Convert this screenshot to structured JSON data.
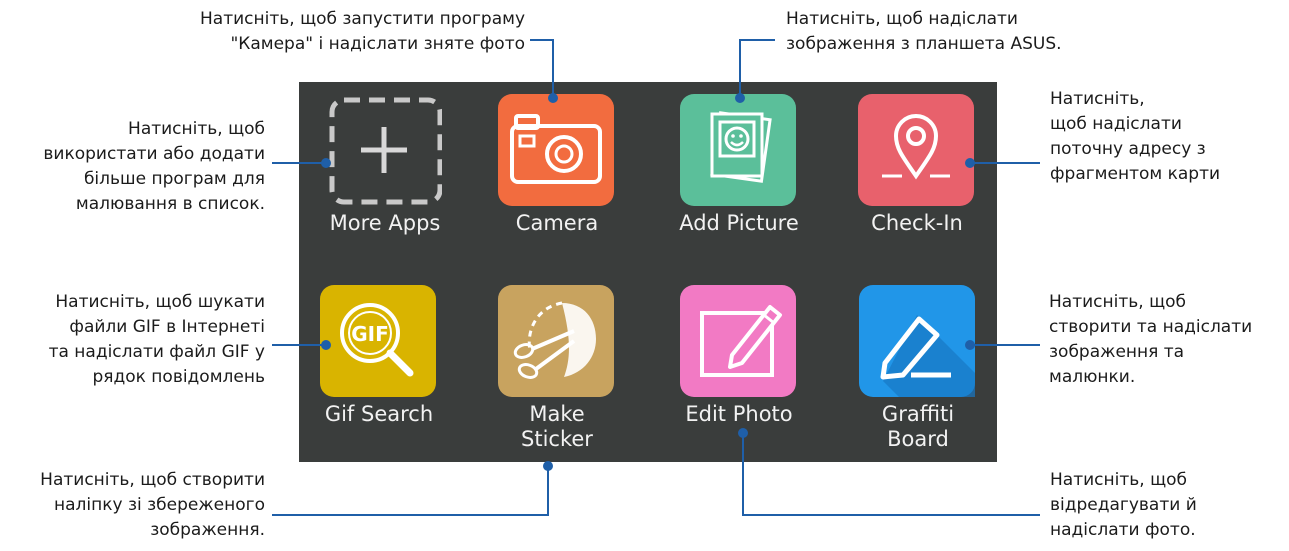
{
  "colors": {
    "panel": "#3a3d3c",
    "leader": "#1f5fa8",
    "camera": "#f26c3f",
    "add_picture": "#5bbf9a",
    "check_in": "#e8616c",
    "gif_search": "#d9b400",
    "make_sticker": "#c8a35f",
    "edit_photo": "#f27ac4",
    "graffiti_board": "#2196e8"
  },
  "apps": [
    {
      "label": "More Apps",
      "icon": "plus-dashed-icon"
    },
    {
      "label": "Camera",
      "icon": "camera-icon"
    },
    {
      "label": "Add Picture",
      "icon": "photo-stack-icon"
    },
    {
      "label": "Check-In",
      "icon": "map-pin-icon"
    },
    {
      "label": "Gif Search",
      "icon": "gif-magnifier-icon"
    },
    {
      "label": "Make\nSticker",
      "icon": "scissors-icon"
    },
    {
      "label": "Edit Photo",
      "icon": "pencil-frame-icon"
    },
    {
      "label": "Graffiti\nBoard",
      "icon": "pen-icon"
    }
  ],
  "callouts": {
    "camera": "Натисніть, щоб запустити програму\n\"Камера\" і надіслати зняте фото",
    "add_picture": "Натисніть, щоб надіслати\nзображення з планшета ASUS.",
    "more_apps": "Натисніть, щоб\nвикористати або додати\nбільше програм для\nмалювання в список.",
    "check_in": "Натисніть,\nщоб надіслати\nпоточну адресу з\nфрагментом карти",
    "gif_search": "Натисніть, щоб шукати\nфайли GIF в Інтернеті\nта надіслати файл GIF у\nрядок повідомлень",
    "graffiti_board": "Натисніть, щоб\nстворити та надіслати\nзображення та\nмалюнки.",
    "make_sticker": "Натисніть, щоб створити\nналіпку зі збереженого\nзображення.",
    "edit_photo": "Натисніть, щоб\nвідредагувати й\nнадіслати фото."
  }
}
